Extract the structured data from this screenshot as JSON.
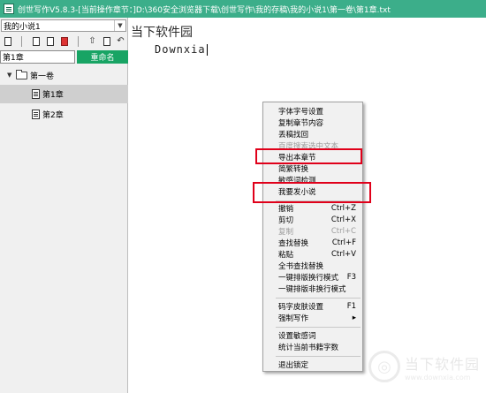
{
  "window": {
    "title": "创世写作V5.8.3-[当前操作章节：]D:\\360安全浏览器下载\\创世写作\\我的存稿\\我的小说1\\第一卷\\第1章.txt"
  },
  "sidebar": {
    "book_select": {
      "value": "我的小说1"
    },
    "toolbar_icons": [
      "new-chapter-icon",
      "new-volume-icon",
      "save-icon",
      "delete-icon",
      "export-icon",
      "copy-icon",
      "undo-icon"
    ],
    "chapter_input": {
      "value": "第1章"
    },
    "rename_label": "重命名",
    "tree": {
      "volume": "第一卷",
      "chapters": [
        {
          "label": "第1章",
          "selected": true
        },
        {
          "label": "第2章",
          "selected": false
        }
      ]
    }
  },
  "editor": {
    "brand": "当下软件园",
    "text": "Downxia"
  },
  "context_menu": {
    "items": [
      {
        "label": "字体字号设置",
        "shortcut": "",
        "disabled": false
      },
      {
        "label": "复制章节内容",
        "shortcut": "",
        "disabled": false
      },
      {
        "label": "丢稿找回",
        "shortcut": "",
        "disabled": false
      },
      {
        "label": "百度搜索选中文本",
        "shortcut": "",
        "disabled": true
      },
      {
        "label": "导出本章节",
        "shortcut": "",
        "disabled": false
      },
      {
        "label": "简繁转换",
        "shortcut": "",
        "disabled": false
      },
      {
        "label": "敏感词检测",
        "shortcut": "",
        "disabled": false
      },
      {
        "label": "我要发小说",
        "shortcut": "",
        "disabled": false
      },
      {
        "label": "撤销",
        "shortcut": "Ctrl+Z",
        "disabled": false
      },
      {
        "label": "剪切",
        "shortcut": "Ctrl+X",
        "disabled": false
      },
      {
        "label": "复制",
        "shortcut": "Ctrl+C",
        "disabled": true
      },
      {
        "label": "查找替换",
        "shortcut": "Ctrl+F",
        "disabled": false
      },
      {
        "label": "粘贴",
        "shortcut": "Ctrl+V",
        "disabled": false
      },
      {
        "label": "全书查找替换",
        "shortcut": "",
        "disabled": false
      },
      {
        "label": "一键排版换行模式",
        "shortcut": "F3",
        "disabled": false
      },
      {
        "label": "一键排版非换行模式",
        "shortcut": "",
        "disabled": false
      },
      {
        "label": "码字皮肤设置",
        "shortcut": "F1",
        "disabled": false
      },
      {
        "label": "强制写作",
        "shortcut": "▸",
        "disabled": false
      },
      {
        "label": "设置敏感词",
        "shortcut": "",
        "disabled": false
      },
      {
        "label": "统计当前书籍字数",
        "shortcut": "",
        "disabled": false
      },
      {
        "label": "退出锁定",
        "shortcut": "",
        "disabled": false
      }
    ],
    "highlight_color": "#e0001a"
  },
  "watermark": {
    "cn": "当下软件园",
    "en": "www.downxia.com"
  }
}
